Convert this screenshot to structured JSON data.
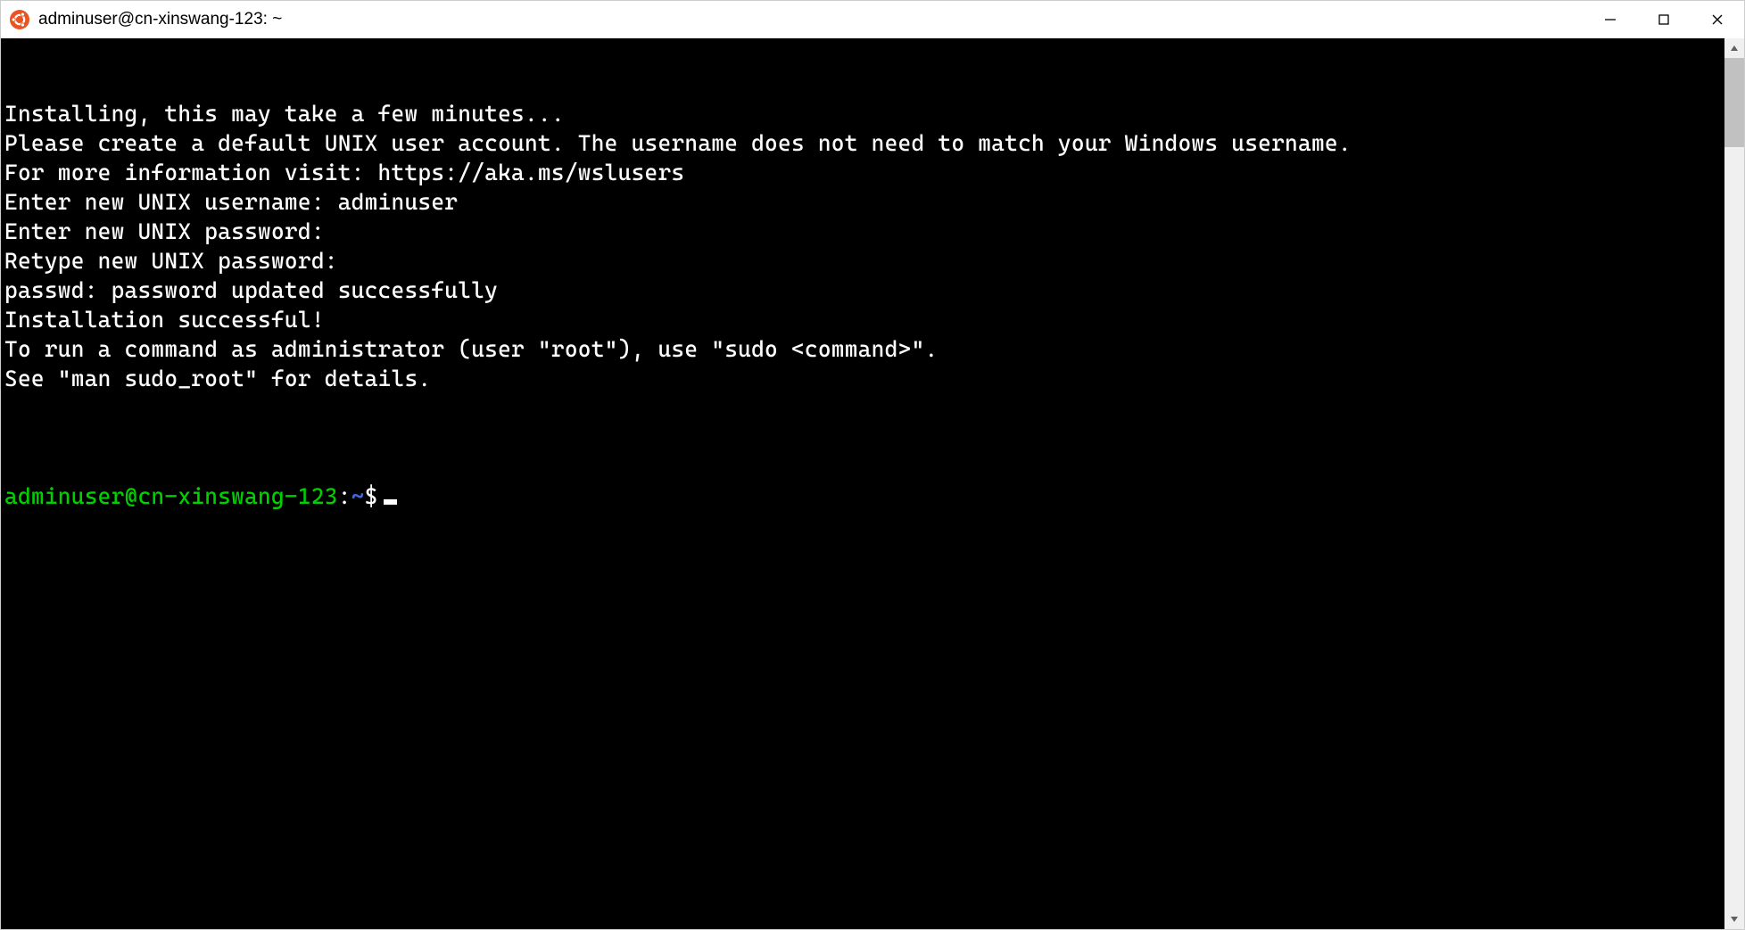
{
  "window": {
    "title": "adminuser@cn-xinswang-123: ~"
  },
  "terminal": {
    "lines": [
      "Installing, this may take a few minutes...",
      "Please create a default UNIX user account. The username does not need to match your Windows username.",
      "For more information visit: https://aka.ms/wslusers",
      "Enter new UNIX username: adminuser",
      "Enter new UNIX password:",
      "Retype new UNIX password:",
      "passwd: password updated successfully",
      "Installation successful!",
      "To run a command as administrator (user \"root\"), use \"sudo <command>\".",
      "See \"man sudo_root\" for details.",
      ""
    ],
    "prompt": {
      "user_host": "adminuser@cn-xinswang-123",
      "colon": ":",
      "path": "~",
      "symbol": "$"
    }
  }
}
